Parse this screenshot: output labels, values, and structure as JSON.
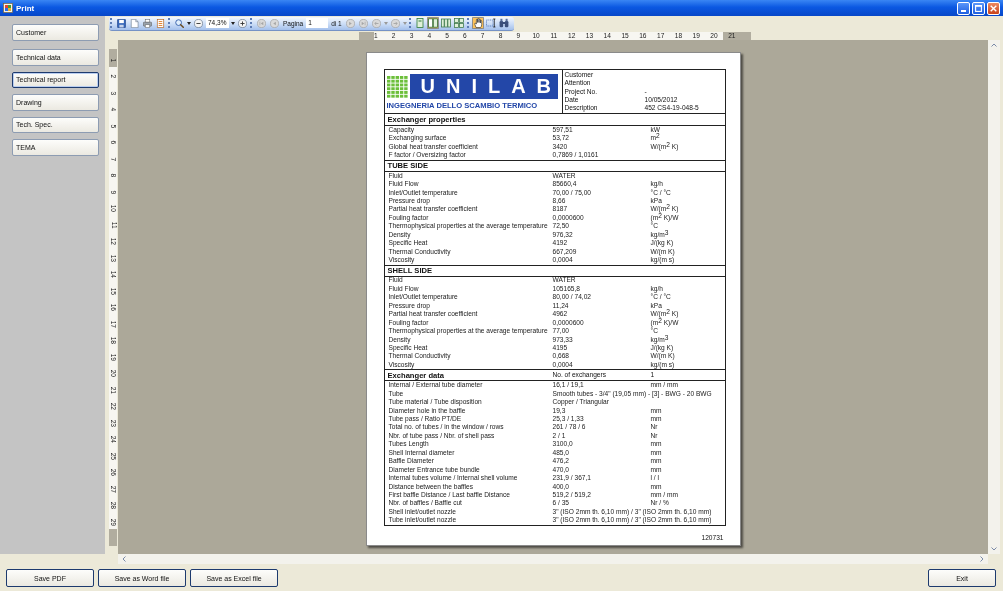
{
  "window": {
    "title": "Print"
  },
  "sidebar": {
    "items": [
      {
        "label": "Customer",
        "selected": false
      },
      {
        "label": "Technical data",
        "selected": false
      },
      {
        "label": "Technical report",
        "selected": true
      },
      {
        "label": "Drawing",
        "selected": false
      },
      {
        "label": "Tech. Spec.",
        "selected": false
      },
      {
        "label": "TEMA",
        "selected": false
      }
    ]
  },
  "toolbar": {
    "file_buttons": [
      {
        "kind": "save"
      },
      {
        "kind": "new"
      },
      {
        "kind": "print"
      },
      {
        "kind": "export"
      }
    ],
    "zoom": {
      "value": "74,3%"
    },
    "navigation": [
      {
        "kind": "first",
        "disabled": true
      },
      {
        "kind": "previous",
        "disabled": true
      },
      {
        "kind": "next",
        "disabled": true
      },
      {
        "kind": "last",
        "disabled": true
      },
      {
        "kind": "back",
        "disabled": true
      },
      {
        "kind": "forward",
        "disabled": true
      }
    ],
    "page": {
      "label": "Pagina",
      "value": "1",
      "total": "di 1"
    },
    "views": [
      {
        "kind": "one-page",
        "selected": false
      },
      {
        "kind": "two-pages",
        "selected": true
      },
      {
        "kind": "three-pages",
        "selected": false
      },
      {
        "kind": "four-pages",
        "selected": false
      }
    ],
    "tools": [
      {
        "kind": "hand",
        "selected": true
      },
      {
        "kind": "text-select",
        "selected": false
      },
      {
        "kind": "find",
        "selected": false
      }
    ]
  },
  "rulers": {
    "horizontal": [
      "1",
      "2",
      "3",
      "4",
      "5",
      "6",
      "7",
      "8",
      "9",
      "10",
      "11",
      "12",
      "13",
      "14",
      "15",
      "16",
      "17",
      "18",
      "19",
      "20",
      "21"
    ],
    "vertical": [
      "1",
      "2",
      "3",
      "4",
      "5",
      "6",
      "7",
      "8",
      "9",
      "10",
      "11",
      "12",
      "13",
      "14",
      "15",
      "16",
      "17",
      "18",
      "19",
      "20",
      "21",
      "22",
      "23",
      "24",
      "25",
      "26",
      "27",
      "28",
      "29"
    ]
  },
  "document": {
    "logo": {
      "name": "UNILAB",
      "tagline": "INGEGNERIA DELLO SCAMBIO TERMICO"
    },
    "header_fields": [
      {
        "label": "Customer"
      },
      {
        "label": "Attention"
      },
      {
        "label": "Project No.",
        "value": "-"
      },
      {
        "label": "Date",
        "value": "10/05/2012"
      },
      {
        "label": "Description",
        "value": "452 CS4-19-048-5"
      }
    ],
    "sections": [
      {
        "title": "Exchanger properties",
        "rows": [
          {
            "label": "Capacity",
            "value": "597,51",
            "unit": "kW"
          },
          {
            "label": "Exchanging surface",
            "value": "53,72",
            "unit": "m$^{2}$"
          },
          {
            "label": "Global heat transfer coefficient",
            "value": "3420",
            "unit": "W/(m$^{2}$ K)"
          },
          {
            "label": "F factor / Oversizing factor",
            "value": "0,7869 / 1,0161"
          }
        ]
      },
      {
        "title": "TUBE SIDE",
        "rows": [
          {
            "label": "Fluid",
            "value": "WATER"
          },
          {
            "label": "Fluid Flow",
            "value": "85660,4",
            "unit": "kg/h"
          },
          {
            "label": "Inlet/Outlet temperature",
            "value": "70,00 / 75,00",
            "unit": "°C / °C"
          },
          {
            "label": "Pressure drop",
            "value": "8,66",
            "unit": "kPa"
          },
          {
            "label": "Partial heat transfer coefficient",
            "value": "8187",
            "unit": "W/(m$^{2}$ K)"
          },
          {
            "label": "Fouling factor",
            "value": "0,0000600",
            "unit": "(m$^{2}$ K)/W"
          },
          {
            "label": "Thermophysical properties at the average temperature",
            "value": "72,50",
            "unit": "°C"
          },
          {
            "label": "Density",
            "value": "976,32",
            "unit": "kg/m$^{3}$"
          },
          {
            "label": "Specific Heat",
            "value": "4192",
            "unit": "J/(kg K)"
          },
          {
            "label": "Thermal Conductivity",
            "value": "667,209",
            "unit": "W/(m K)"
          },
          {
            "label": "Viscosity",
            "value": "0,0004",
            "unit": "kg/(m s)"
          }
        ]
      },
      {
        "title": "SHELL SIDE",
        "rows": [
          {
            "label": "Fluid",
            "value": "WATER"
          },
          {
            "label": "Fluid Flow",
            "value": "105165,8",
            "unit": "kg/h"
          },
          {
            "label": "Inlet/Outlet temperature",
            "value": "80,00 / 74,02",
            "unit": "°C / °C"
          },
          {
            "label": "Pressure drop",
            "value": "11,24",
            "unit": "kPa"
          },
          {
            "label": "Partial heat transfer coefficient",
            "value": "4962",
            "unit": "W/(m$^{2}$ K)"
          },
          {
            "label": "Fouling factor",
            "value": "0,0000600",
            "unit": "(m$^{2}$ K)/W"
          },
          {
            "label": "Thermophysical properties at the average temperature",
            "value": "77,00",
            "unit": "°C"
          },
          {
            "label": "Density",
            "value": "973,33",
            "unit": "kg/m$^{3}$"
          },
          {
            "label": "Specific Heat",
            "value": "4195",
            "unit": "J/(kg K)"
          },
          {
            "label": "Thermal Conductivity",
            "value": "0,668",
            "unit": "W/(m K)"
          },
          {
            "label": "Viscosity",
            "value": "0,0004",
            "unit": "kg/(m s)"
          }
        ]
      },
      {
        "title": "Exchanger data",
        "value": "No. of exchangers",
        "unit": "1",
        "rows": [
          {
            "label": "Internal / External tube diameter",
            "value": "16,1 / 19,1",
            "unit": "mm / mm"
          },
          {
            "label": "Tube",
            "value": "Smooth tubes - 3/4\" (19,05 mm) - [3] - BWG - 20 BWG"
          },
          {
            "label": "Tube material / Tube disposition",
            "value": "Copper / Triangular"
          },
          {
            "label": "Diameter hole in the baffle",
            "value": "19,3",
            "unit": "mm"
          },
          {
            "label": "Tube pass / Ratio PT/DE",
            "value": "25,3 / 1,33",
            "unit": "mm"
          },
          {
            "label": "Total no. of tubes / in the window / rows",
            "value": "261 / 78 / 6",
            "unit": "Nr"
          },
          {
            "label": "Nbr. of tube pass / Nbr. of shell pass",
            "value": "2 / 1",
            "unit": "Nr"
          },
          {
            "label": "Tubes Length",
            "value": "3100,0",
            "unit": "mm"
          },
          {
            "label": "Shell Internal diameter",
            "value": "485,0",
            "unit": "mm"
          },
          {
            "label": "Baffle Diameter",
            "value": "476,2",
            "unit": "mm"
          },
          {
            "label": "Diameter Entrance tube bundle",
            "value": "470,0",
            "unit": "mm"
          },
          {
            "label": "Internal tubes volume / Internal shell volume",
            "value": "231,9 / 367,1",
            "unit": "l / l"
          },
          {
            "label": "Distance between the baffles",
            "value": "400,0",
            "unit": "mm"
          },
          {
            "label": "First baffle Distance / Last baffle Distance",
            "value": "519,2 / 519,2",
            "unit": "mm / mm"
          },
          {
            "label": "Nbr. of baffles / Baffle cut",
            "value": "6 / 35",
            "unit": "Nr / %"
          },
          {
            "label": "Shell inlet/outlet nozzle",
            "value": "3\" (ISO 2mm th. 6,10 mm) / 3\" (ISO 2mm th. 6,10 mm)"
          },
          {
            "label": "Tube inlet/outlet nozzle",
            "value": "3\" (ISO 2mm th. 6,10 mm) / 3\" (ISO 2mm th. 6,10 mm)"
          }
        ]
      }
    ],
    "code": "120731"
  },
  "buttons": [
    {
      "label": "Save PDF"
    },
    {
      "label": "Save as Word file"
    },
    {
      "label": "Save as Excel file"
    }
  ],
  "exit_button": {
    "label": "Exit"
  }
}
